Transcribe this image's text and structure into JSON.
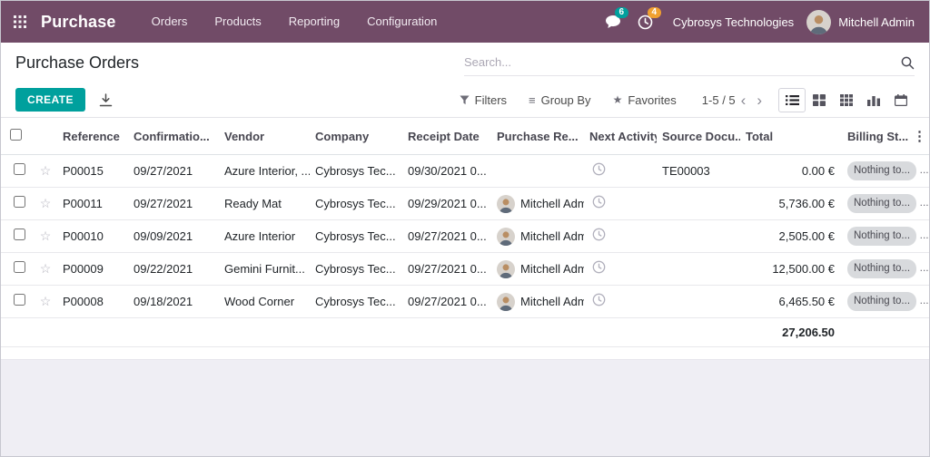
{
  "nav": {
    "app_name": "Purchase",
    "menus": [
      "Orders",
      "Products",
      "Reporting",
      "Configuration"
    ],
    "messages_badge": "6",
    "activities_badge": "4",
    "company": "Cybrosys Technologies",
    "user_name": "Mitchell Admin"
  },
  "header": {
    "title": "Purchase Orders",
    "search_placeholder": "Search..."
  },
  "controls": {
    "create": "CREATE",
    "filters": "Filters",
    "group_by": "Group By",
    "favorites": "Favorites",
    "pager": "1-5 / 5"
  },
  "icons": {
    "group_by": "≡",
    "favorite": "★",
    "chevron_left": "‹",
    "chevron_right": "›",
    "row_star": "☆",
    "kebab": "⋮"
  },
  "table": {
    "headers": {
      "reference": "Reference",
      "confirmation": "Confirmatio...",
      "vendor": "Vendor",
      "company": "Company",
      "receipt": "Receipt Date",
      "rep": "Purchase Re...",
      "activity": "Next Activity",
      "source": "Source Docu...",
      "total": "Total",
      "billing": "Billing St..."
    },
    "billing_suffix": "...",
    "rows": [
      {
        "reference": "P00015",
        "confirmation": "09/27/2021",
        "vendor": "Azure Interior, ...",
        "company": "Cybrosys Tec...",
        "receipt": "09/30/2021 0...",
        "rep": "",
        "source": "TE00003",
        "total": "0.00 €",
        "billing": "Nothing to..."
      },
      {
        "reference": "P00011",
        "confirmation": "09/27/2021",
        "vendor": "Ready Mat",
        "company": "Cybrosys Tec...",
        "receipt": "09/29/2021 0...",
        "rep": "Mitchell Adm...",
        "source": "",
        "total": "5,736.00 €",
        "billing": "Nothing to..."
      },
      {
        "reference": "P00010",
        "confirmation": "09/09/2021",
        "vendor": "Azure Interior",
        "company": "Cybrosys Tec...",
        "receipt": "09/27/2021 0...",
        "rep": "Mitchell Adm...",
        "source": "",
        "total": "2,505.00 €",
        "billing": "Nothing to..."
      },
      {
        "reference": "P00009",
        "confirmation": "09/22/2021",
        "vendor": "Gemini Furnit...",
        "company": "Cybrosys Tec...",
        "receipt": "09/27/2021 0...",
        "rep": "Mitchell Adm...",
        "source": "",
        "total": "12,500.00 €",
        "billing": "Nothing to..."
      },
      {
        "reference": "P00008",
        "confirmation": "09/18/2021",
        "vendor": "Wood Corner",
        "company": "Cybrosys Tec...",
        "receipt": "09/27/2021 0...",
        "rep": "Mitchell Adm...",
        "source": "",
        "total": "6,465.50 €",
        "billing": "Nothing to..."
      }
    ],
    "total_sum": "27,206.50"
  },
  "colors": {
    "topbar": "#714B67",
    "primary_button": "#00A09D",
    "messages_badge": "#00A09D",
    "activities_badge": "#F0A030",
    "page_background": "#efeef4"
  }
}
